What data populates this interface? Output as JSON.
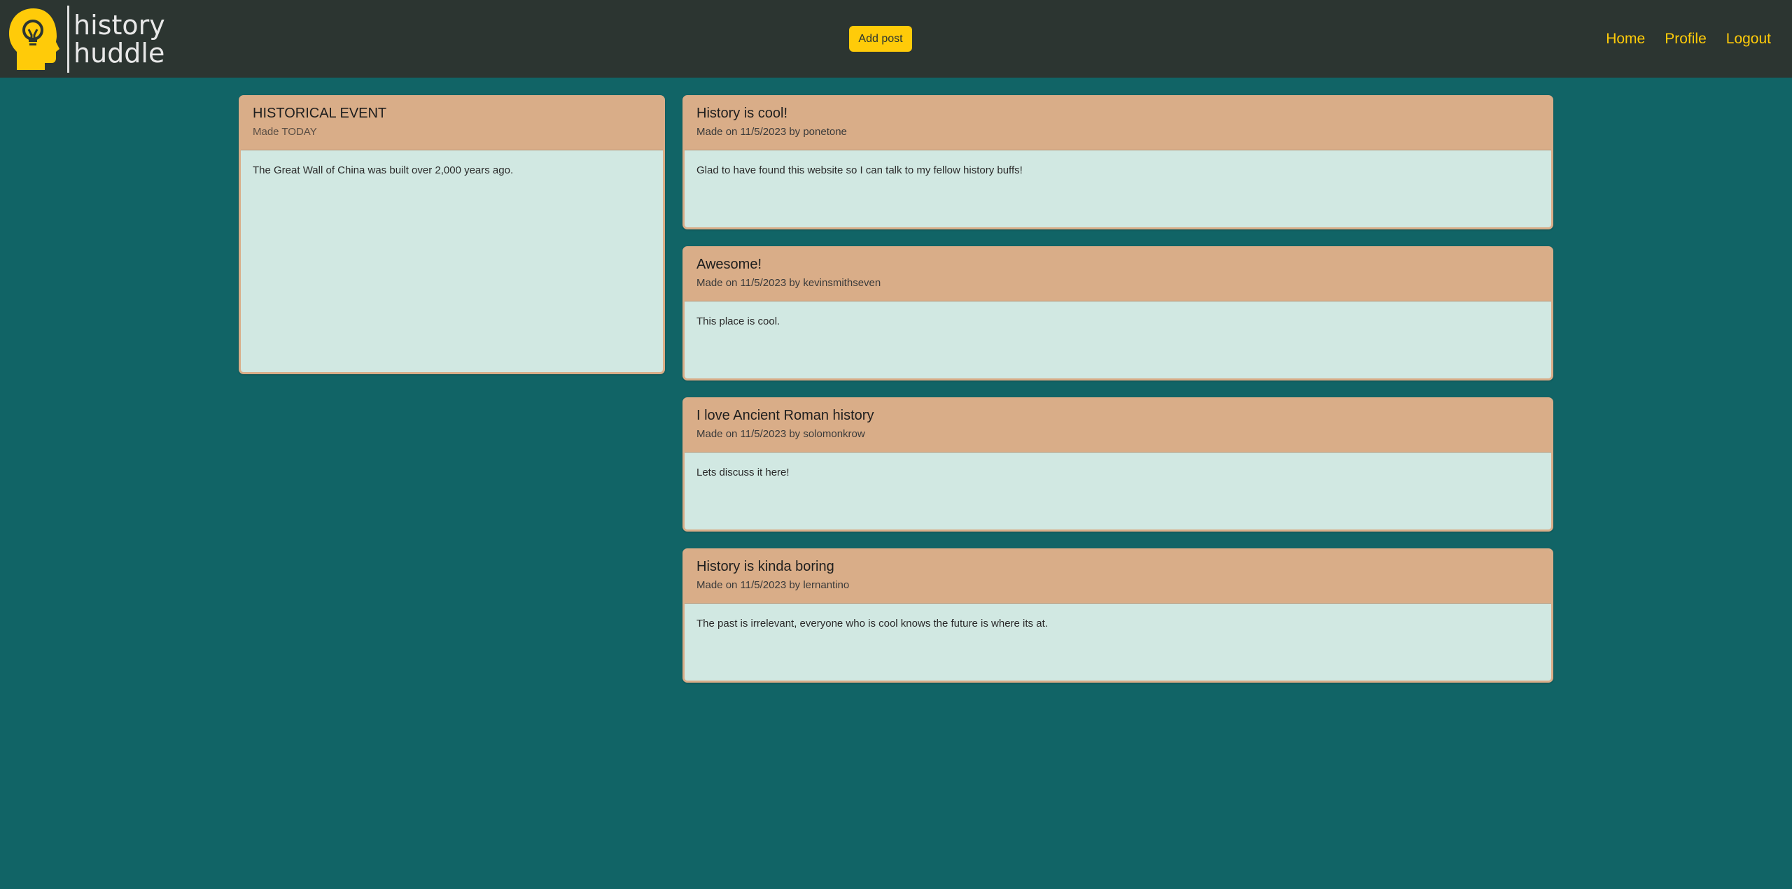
{
  "brand": {
    "line1": "history",
    "line2": "huddle",
    "logo_icon": "head-lightbulb-icon",
    "accent": "#ffcb09"
  },
  "navbar": {
    "add_post_label": "Add post",
    "links": [
      "Home",
      "Profile",
      "Logout"
    ]
  },
  "colors": {
    "page_bg": "#116466",
    "navbar_bg": "#2c3531",
    "card_header": "#d9ad88",
    "card_body": "#d1e8e2",
    "accent": "#ffcb09"
  },
  "event": {
    "title": "HISTORICAL EVENT",
    "meta": "Made TODAY",
    "body": "The Great Wall of China was built over 2,000 years ago."
  },
  "posts": [
    {
      "title": "History is cool!",
      "meta": "Made on 11/5/2023 by ponetone",
      "body": "Glad to have found this website so I can talk to my fellow history buffs!"
    },
    {
      "title": "Awesome!",
      "meta": "Made on 11/5/2023 by kevinsmithseven",
      "body": "This place is cool."
    },
    {
      "title": "I love Ancient Roman history",
      "meta": "Made on 11/5/2023 by solomonkrow",
      "body": "Lets discuss it here!"
    },
    {
      "title": "History is kinda boring",
      "meta": "Made on 11/5/2023 by lernantino",
      "body": "The past is irrelevant, everyone who is cool knows the future is where its at."
    }
  ]
}
